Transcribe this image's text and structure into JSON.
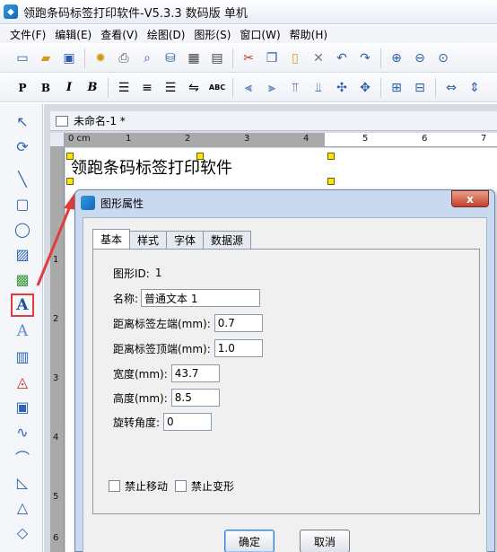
{
  "window": {
    "title": "领跑条码标签打印软件-V5.3.3 数码版 单机"
  },
  "menu": [
    "文件(F)",
    "编辑(E)",
    "查看(V)",
    "绘图(D)",
    "图形(S)",
    "窗口(W)",
    "帮助(H)"
  ],
  "toolbar": {
    "bold_label": "B",
    "italic_label": "I",
    "bold_italic_label": "B",
    "bold_p_label": "P",
    "small_caps_label": "ABC"
  },
  "document": {
    "tab_title": "未命名-1 *",
    "canvas_text": "领跑条码标签打印软件",
    "ruler_unit": "0 cm",
    "ruler_top_labels": [
      "1",
      "2",
      "3",
      "4",
      "5",
      "6",
      "7"
    ],
    "ruler_left_labels": [
      "1",
      "2",
      "3",
      "4",
      "5",
      "6"
    ]
  },
  "palette": {
    "text_tool_label": "A",
    "text_tool_alt_label": "A"
  },
  "dialog": {
    "title": "图形属性",
    "close_label": "x",
    "tabs": [
      "基本",
      "样式",
      "字体",
      "数据源"
    ],
    "active_tab": "基本",
    "shape_id_label": "图形ID:",
    "shape_id_value": "1",
    "name_label": "名称:",
    "name_value": "普通文本 1",
    "left_label": "距离标签左端(mm):",
    "left_value": "0.7",
    "top_label": "距离标签顶端(mm):",
    "top_value": "1.0",
    "width_label": "宽度(mm):",
    "width_value": "43.7",
    "height_label": "高度(mm):",
    "height_value": "8.5",
    "rotation_label": "旋转角度:",
    "rotation_value": "0",
    "no_move_label": "禁止移动",
    "no_transform_label": "禁止变形",
    "ok_label": "确定",
    "cancel_label": "取消"
  }
}
